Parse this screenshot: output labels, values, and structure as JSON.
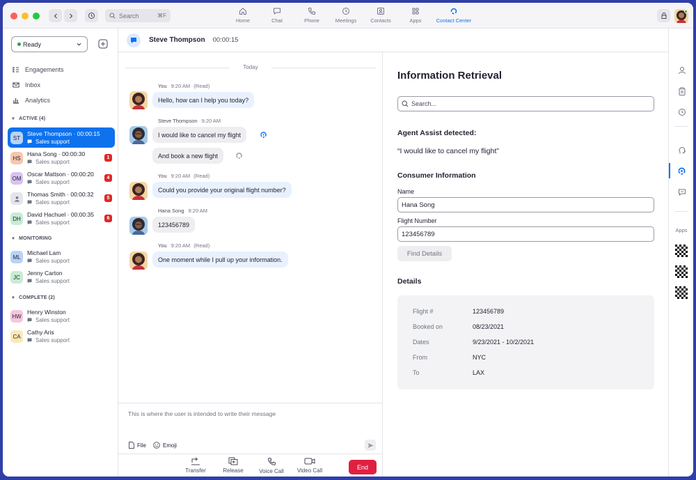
{
  "titlebar": {
    "search_placeholder": "Search",
    "search_shortcut": "⌘F",
    "nav": [
      {
        "label": "Home",
        "icon": "home-icon"
      },
      {
        "label": "Chat",
        "icon": "chat-icon"
      },
      {
        "label": "Phone",
        "icon": "phone-icon"
      },
      {
        "label": "Meetings",
        "icon": "clock-icon"
      },
      {
        "label": "Contacts",
        "icon": "contacts-icon"
      },
      {
        "label": "Apps",
        "icon": "apps-icon"
      },
      {
        "label": "Contact Center",
        "icon": "contact-center-icon"
      }
    ],
    "active_nav": "Contact Center"
  },
  "sidebar": {
    "status": "Ready",
    "links": [
      {
        "label": "Engagements",
        "icon": "engagements-icon"
      },
      {
        "label": "Inbox",
        "icon": "inbox-icon"
      },
      {
        "label": "Analytics",
        "icon": "analytics-icon"
      }
    ],
    "sections": {
      "active": {
        "title": "ACTIVE (4)",
        "items": [
          {
            "initials": "ST",
            "name": "Steve Thompson · 00:00:15",
            "sub": "Sales support",
            "badge": "",
            "avatar_color": "#b9d3f7"
          },
          {
            "initials": "HS",
            "name": "Hana Song · 00:00:30",
            "sub": "Sales support",
            "badge": "1",
            "avatar_color": "#f7c6ad"
          },
          {
            "initials": "OM",
            "name": "Oscar Mattson · 00:00:20",
            "sub": "Sales support",
            "badge": "4",
            "avatar_color": "#d7c3f2"
          },
          {
            "initials": "",
            "name": "Thomas Smith · 00:00:32",
            "sub": "Sales support",
            "badge": "5",
            "avatar_color": "#e4e4ea"
          },
          {
            "initials": "DH",
            "name": "David Hachuel · 00:00:35",
            "sub": "Sales support",
            "badge": "6",
            "avatar_color": "#c8ecd4"
          }
        ]
      },
      "monitoring": {
        "title": "MONITORING",
        "items": [
          {
            "initials": "ML",
            "name": "Michael Lam",
            "sub": "Sales support",
            "avatar_color": "#b9d3f7"
          },
          {
            "initials": "JC",
            "name": "Jenny Carton",
            "sub": "Sales support",
            "avatar_color": "#c8ecd4"
          }
        ]
      },
      "complete": {
        "title": "COMPLETE (2)",
        "items": [
          {
            "initials": "HW",
            "name": "Henry Winston",
            "sub": "Sales support",
            "avatar_color": "#f6c6dc"
          },
          {
            "initials": "CA",
            "name": "Cathy Aris",
            "sub": "Sales support",
            "avatar_color": "#fbe9b5"
          }
        ]
      }
    }
  },
  "chat": {
    "header_name": "Steve Thompson",
    "header_timer": "00:00:15",
    "day_divider": "Today",
    "messages": [
      {
        "sender": "You",
        "time": "9:20 AM",
        "status": "(Read)",
        "text": "Hello, how can I help you today?",
        "mine": true
      },
      {
        "sender": "Steve Thompson",
        "time": "9:20 AM",
        "status": "",
        "text": "I would like to cancel my flight",
        "mine": false
      },
      {
        "sender": "",
        "time": "",
        "status": "",
        "text": "And book a new flight",
        "mine": false
      },
      {
        "sender": "You",
        "time": "9:20 AM",
        "status": "(Read)",
        "text": "Could you provide your original flight number?",
        "mine": true
      },
      {
        "sender": "Hana Song",
        "time": "9:20 AM",
        "status": "",
        "text": "123456789",
        "mine": false
      },
      {
        "sender": "You",
        "time": "9:20 AM",
        "status": "(Read)",
        "text": "One moment while I pull up your information.",
        "mine": true
      }
    ],
    "composer_placeholder": "This is where the user is intended to write their message",
    "tools": {
      "file": "File",
      "emoji": "Emoji"
    },
    "actions": {
      "transfer": "Transfer",
      "release": "Release",
      "voice": "Voice Call",
      "video": "Video Call",
      "end": "End"
    }
  },
  "info": {
    "title": "Information Retrieval",
    "search_placeholder": "Search...",
    "assist_heading": "Agent Assist detected:",
    "assist_quote": "“I would like to cancel my flight”",
    "consumer_heading": "Consumer Information",
    "name_label": "Name",
    "name_value": "Hana Song",
    "flight_label": "Flight Number",
    "flight_value": "123456789",
    "find_button": "Find Details",
    "details_heading": "Details",
    "details": [
      {
        "key": "Flight #",
        "value": "123456789"
      },
      {
        "key": "Booked on",
        "value": "08/23/2021"
      },
      {
        "key": "Dates",
        "value": "9/23/2021 - 10/2/2021"
      },
      {
        "key": "From",
        "value": "NYC"
      },
      {
        "key": "To",
        "value": "LAX"
      }
    ]
  },
  "rail": {
    "apps_label": "Apps"
  },
  "colors": {
    "accent": "#0e72ed",
    "end_button": "#e02040",
    "badge": "#e02828",
    "ready_dot": "#26a346"
  }
}
